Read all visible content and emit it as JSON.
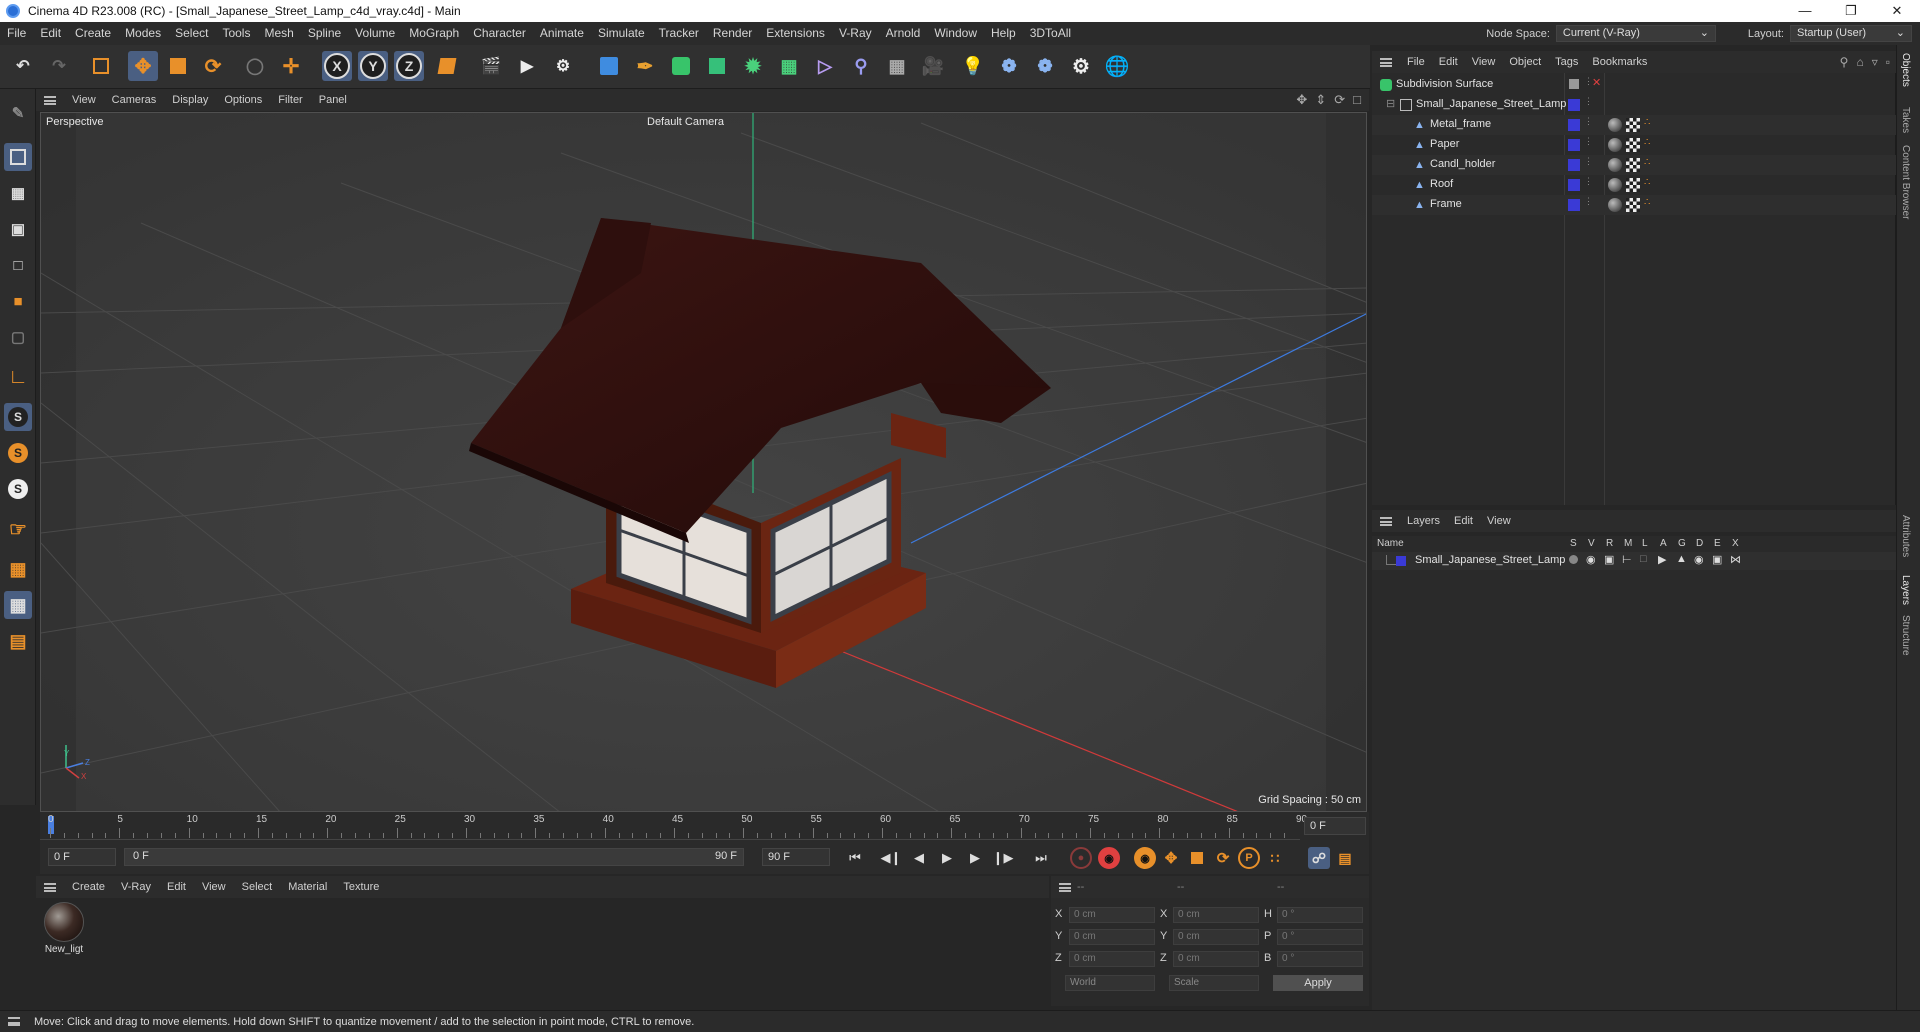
{
  "window": {
    "title": "Cinema 4D R23.008 (RC) - [Small_Japanese_Street_Lamp_c4d_vray.c4d] - Main"
  },
  "menubar": {
    "items": [
      "File",
      "Edit",
      "Create",
      "Modes",
      "Select",
      "Tools",
      "Mesh",
      "Spline",
      "Volume",
      "MoGraph",
      "Character",
      "Animate",
      "Simulate",
      "Tracker",
      "Render",
      "Extensions",
      "V-Ray",
      "Arnold",
      "Window",
      "Help",
      "3DToAll"
    ],
    "node_space_label": "Node Space:",
    "node_space_value": "Current (V-Ray)",
    "layout_label": "Layout:",
    "layout_value": "Startup (User)"
  },
  "toolbar": {
    "axis_x": "X",
    "axis_y": "Y",
    "axis_z": "Z"
  },
  "viewport": {
    "menu": [
      "View",
      "Cameras",
      "Display",
      "Options",
      "Filter",
      "Panel"
    ],
    "projection": "Perspective",
    "camera": "Default Camera",
    "grid_spacing": "Grid Spacing : 50 cm",
    "axis_y": "Y",
    "axis_z": "Z",
    "axis_x": "X"
  },
  "timeline": {
    "ticks": [
      "0",
      "5",
      "10",
      "15",
      "20",
      "25",
      "30",
      "35",
      "40",
      "45",
      "50",
      "55",
      "60",
      "65",
      "70",
      "75",
      "80",
      "85",
      "90"
    ],
    "current_frame_display": "0 F",
    "start_field": "0 F",
    "range_start": "0 F",
    "range_end": "90 F",
    "end_field": "90 F"
  },
  "material_manager": {
    "menu": [
      "Create",
      "V-Ray",
      "Edit",
      "View",
      "Select",
      "Material",
      "Texture"
    ],
    "materials": [
      {
        "name": "New_ligt"
      }
    ]
  },
  "coordinates": {
    "header": [
      "--",
      "--",
      "--"
    ],
    "rows": [
      {
        "axis": "X",
        "pos": "0 cm",
        "size_axis": "X",
        "size": "0 cm",
        "rot_axis": "H",
        "rot": "0 °"
      },
      {
        "axis": "Y",
        "pos": "0 cm",
        "size_axis": "Y",
        "size": "0 cm",
        "rot_axis": "P",
        "rot": "0 °"
      },
      {
        "axis": "Z",
        "pos": "0 cm",
        "size_axis": "Z",
        "size": "0 cm",
        "rot_axis": "B",
        "rot": "0 °"
      }
    ],
    "mode_world": "World",
    "mode_scale": "Scale",
    "apply": "Apply"
  },
  "object_manager": {
    "menu": [
      "File",
      "Edit",
      "View",
      "Object",
      "Tags",
      "Bookmarks"
    ],
    "objects": [
      {
        "name": "Subdivision Surface",
        "level": 0
      },
      {
        "name": "Small_Japanese_Street_Lamp",
        "level": 1
      },
      {
        "name": "Metal_frame",
        "level": 2
      },
      {
        "name": "Paper",
        "level": 2
      },
      {
        "name": "Candl_holder",
        "level": 2
      },
      {
        "name": "Roof",
        "level": 2
      },
      {
        "name": "Frame",
        "level": 2
      }
    ]
  },
  "layers": {
    "menu": [
      "Layers",
      "Edit",
      "View"
    ],
    "columns": [
      "Name",
      "S",
      "V",
      "R",
      "M",
      "L",
      "A",
      "G",
      "D",
      "E",
      "X"
    ],
    "items": [
      {
        "name": "Small_Japanese_Street_Lamp",
        "color": "#3a3ad6"
      }
    ]
  },
  "side_tabs": [
    "Objects",
    "Takes",
    "Content Browser",
    "Attributes",
    "Layers",
    "Structure"
  ],
  "status": "Move: Click and drag to move elements. Hold down SHIFT to quantize movement / add to the selection in point mode, CTRL to remove.",
  "colors": {
    "accent": "#4a5f82",
    "layer_blue": "#3a3ad6",
    "orange": "#e8902a"
  }
}
